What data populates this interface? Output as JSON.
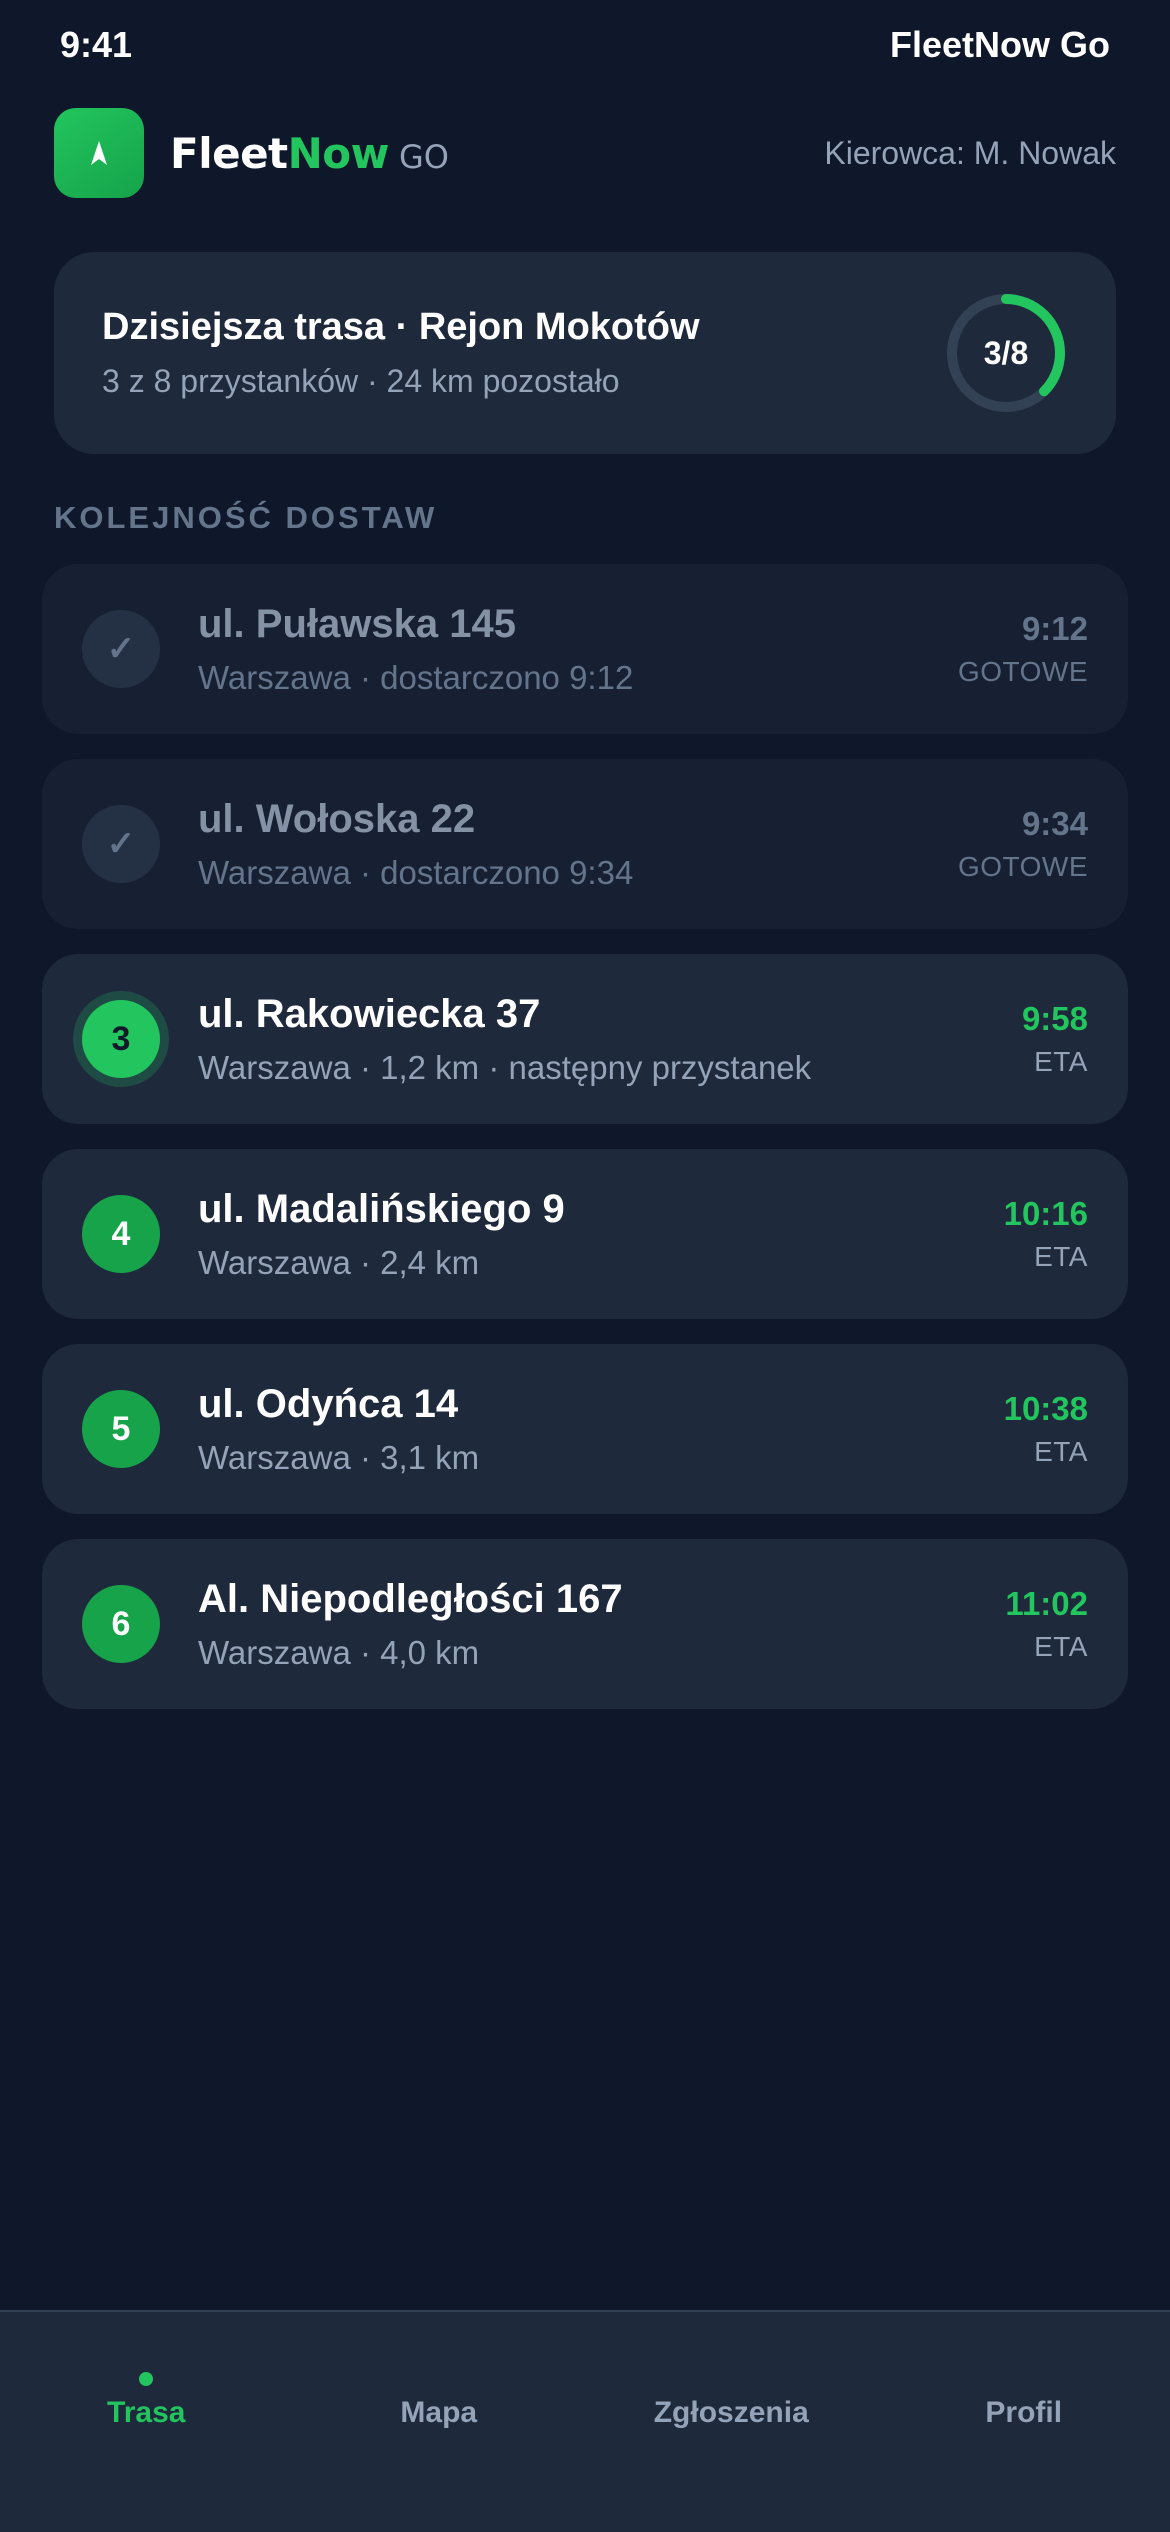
{
  "status_bar": {
    "time": "9:41",
    "carrier": "FleetNow Go"
  },
  "header": {
    "brand_part1": "Fleet",
    "brand_part2": "Now",
    "brand_suffix": "GO",
    "driver": "Kierowca: M. Nowak",
    "logo_icon": "navigation-arrow-icon"
  },
  "route": {
    "title": "Dzisiejsza trasa · Rejon Mokotów",
    "subtitle": "3 z 8 przystanków · 24 km pozostało",
    "progress_label": "3/8",
    "progress_fraction": 0.375
  },
  "section_label": "KOLEJNOŚĆ DOSTAW",
  "stops": [
    {
      "badge": "✓",
      "title": "ul. Puławska 145",
      "subtitle": "Warszawa · dostarczono 9:12",
      "time": "9:12",
      "tag": "GOTOWE"
    },
    {
      "badge": "✓",
      "title": "ul. Wołoska 22",
      "subtitle": "Warszawa · dostarczono 9:34",
      "time": "9:34",
      "tag": "GOTOWE"
    },
    {
      "badge": "3",
      "title": "ul. Rakowiecka 37",
      "subtitle": "Warszawa · 1,2 km · następny przystanek",
      "time": "9:58",
      "tag": "ETA"
    },
    {
      "badge": "4",
      "title": "ul. Madalińskiego 9",
      "subtitle": "Warszawa · 2,4 km",
      "time": "10:16",
      "tag": "ETA"
    },
    {
      "badge": "5",
      "title": "ul. Odyńca 14",
      "subtitle": "Warszawa · 3,1 km",
      "time": "10:38",
      "tag": "ETA"
    },
    {
      "badge": "6",
      "title": "Al. Niepodległości 167",
      "subtitle": "Warszawa · 4,0 km",
      "time": "11:02",
      "tag": "ETA"
    }
  ],
  "tabs": [
    {
      "label": "Trasa",
      "active": true
    },
    {
      "label": "Mapa",
      "active": false
    },
    {
      "label": "Zgłoszenia",
      "active": false
    },
    {
      "label": "Profil",
      "active": false
    }
  ],
  "colors": {
    "accent": "#22c55e",
    "background": "#0f172a",
    "card": "#1e293b"
  }
}
